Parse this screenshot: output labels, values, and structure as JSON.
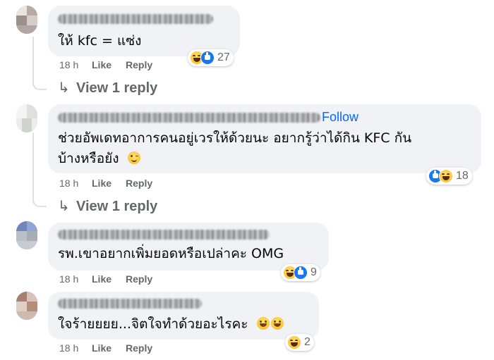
{
  "comments": [
    {
      "text": "ให้ kfc = แซ่ง",
      "time": "18 h",
      "like_label": "Like",
      "reply_label": "Reply",
      "reaction_count": "27",
      "reaction_icons": [
        "haha-icon",
        "like-icon"
      ],
      "view_replies": "View 1 reply"
    },
    {
      "follow_label": "Follow",
      "text_line1": "ช่วยอัพเดทอาการคนอยู่เวรให้ด้วยนะ อยากรู้ว่าได้กิน KFC กัน",
      "text_line2": "บ้างหรือยัง",
      "emoji": "smirk-emoji",
      "time": "18 h",
      "like_label": "Like",
      "reply_label": "Reply",
      "reaction_count": "18",
      "reaction_icons": [
        "like-icon",
        "haha-icon"
      ],
      "view_replies": "View 1 reply"
    },
    {
      "text": "รพ.เขาอยากเพิ่มยอดหรือเปล่าคะ OMG",
      "time": "18 h",
      "like_label": "Like",
      "reply_label": "Reply",
      "reaction_count": "9",
      "reaction_icons": [
        "haha-icon",
        "like-icon"
      ]
    },
    {
      "text": "ใจร้ายยยย...จิตใจทำด้วยอะไรคะ",
      "emoji": "grin-emoji",
      "time": "18 h",
      "like_label": "Like",
      "reply_label": "Reply",
      "reaction_count": "2",
      "reaction_icons": [
        "haha-icon"
      ]
    }
  ],
  "colors": {
    "bubble": "#f0f2f5",
    "meta_text": "#65676b",
    "follow_link": "#0866ff",
    "like_blue": "#1877f2"
  }
}
